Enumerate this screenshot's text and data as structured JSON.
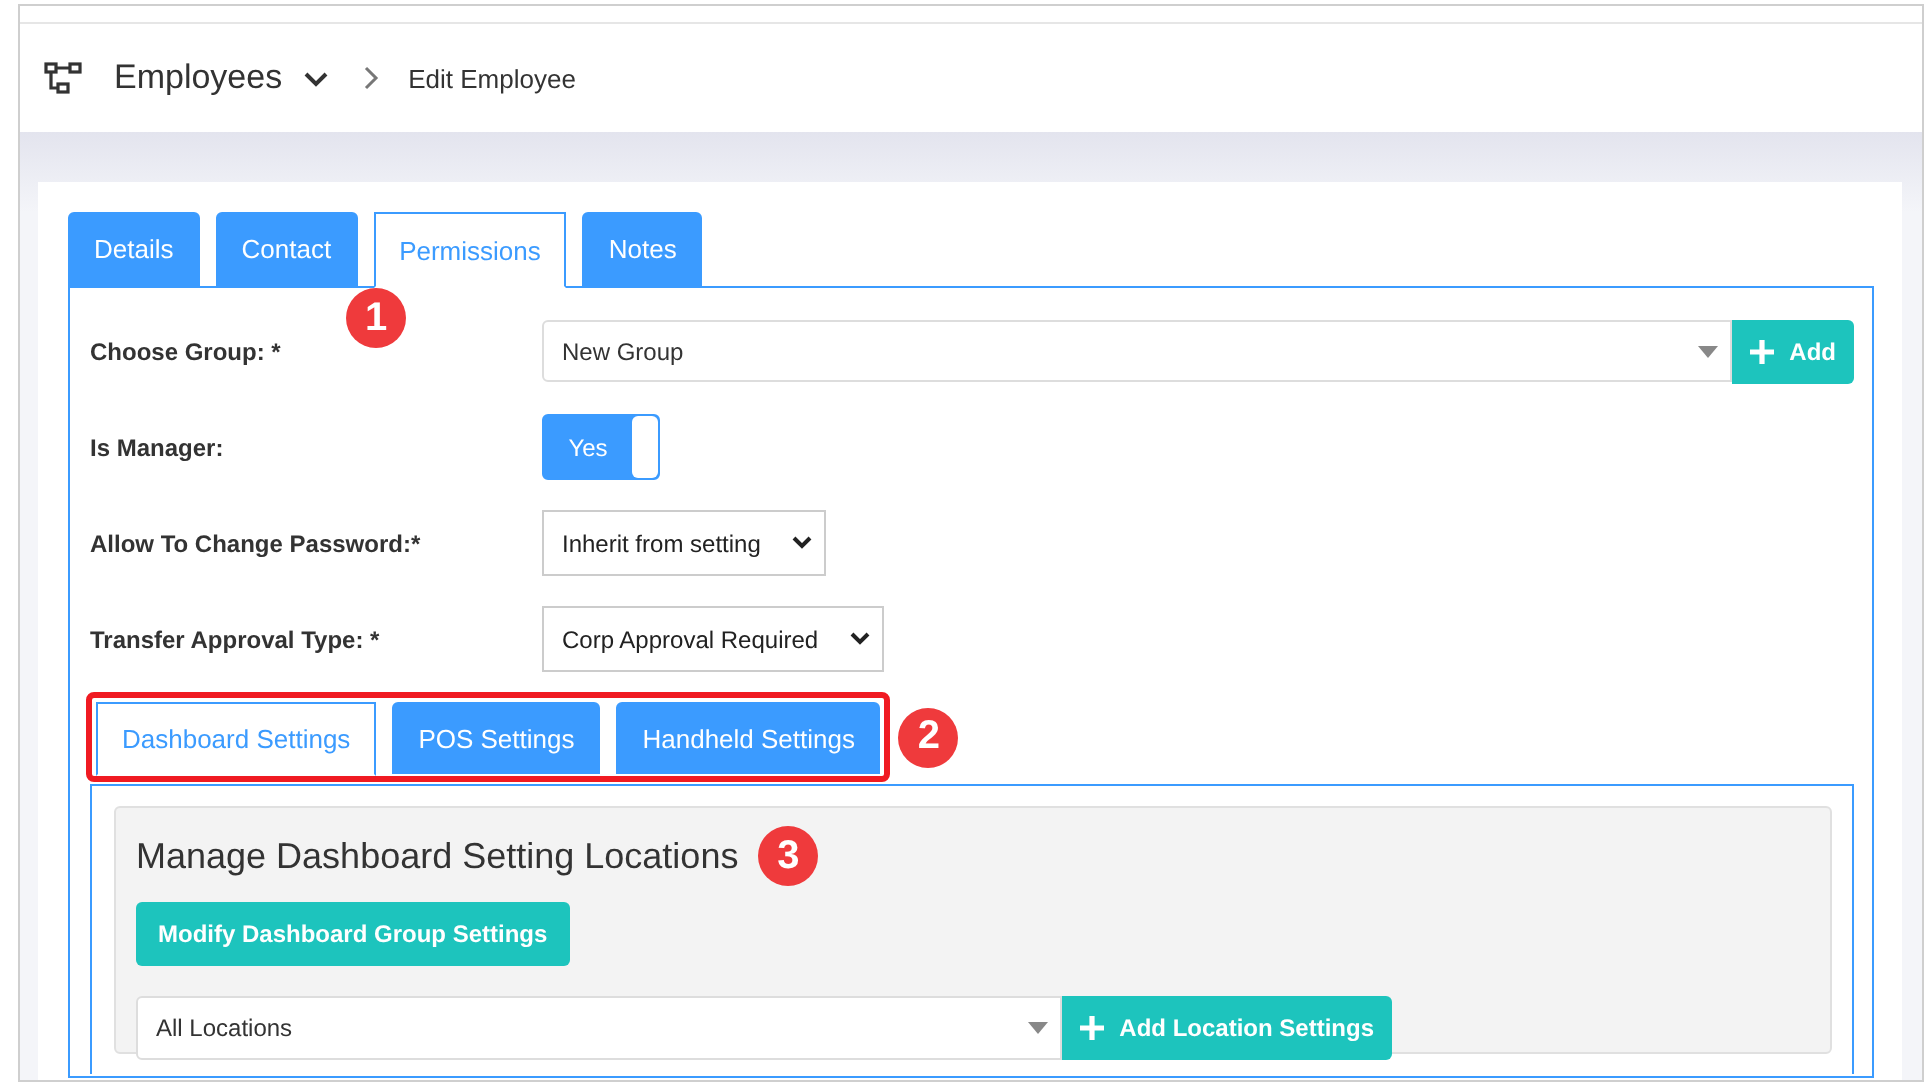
{
  "breadcrumb": {
    "section": "Employees",
    "page": "Edit Employee"
  },
  "tabs": [
    {
      "label": "Details",
      "selected": false
    },
    {
      "label": "Contact",
      "selected": false
    },
    {
      "label": "Permissions",
      "selected": true
    },
    {
      "label": "Notes",
      "selected": false
    }
  ],
  "form": [
    {
      "label": "Choose Group: *",
      "kind": "combo",
      "value": "New Group",
      "button": "Add"
    },
    {
      "label": "Is Manager:",
      "kind": "toggle",
      "value": "Yes",
      "on": true
    },
    {
      "label": "Allow To Change Password:*",
      "kind": "select",
      "value": "Inherit from setting"
    },
    {
      "label": "Transfer Approval Type: *",
      "kind": "select",
      "value": "Corp Approval Required"
    }
  ],
  "sub_tabs": {
    "highlighted": true,
    "items": [
      {
        "label": "Dashboard Settings",
        "selected": true
      },
      {
        "label": "POS Settings",
        "selected": false
      },
      {
        "label": "Handheld Settings",
        "selected": false
      }
    ]
  },
  "dashboard_panel": {
    "title": "Manage Dashboard Setting Locations",
    "modify_button": "Modify Dashboard Group Settings",
    "location_value": "All Locations",
    "add_button": "Add Location Settings"
  },
  "callouts": [
    "1",
    "2",
    "3"
  ]
}
